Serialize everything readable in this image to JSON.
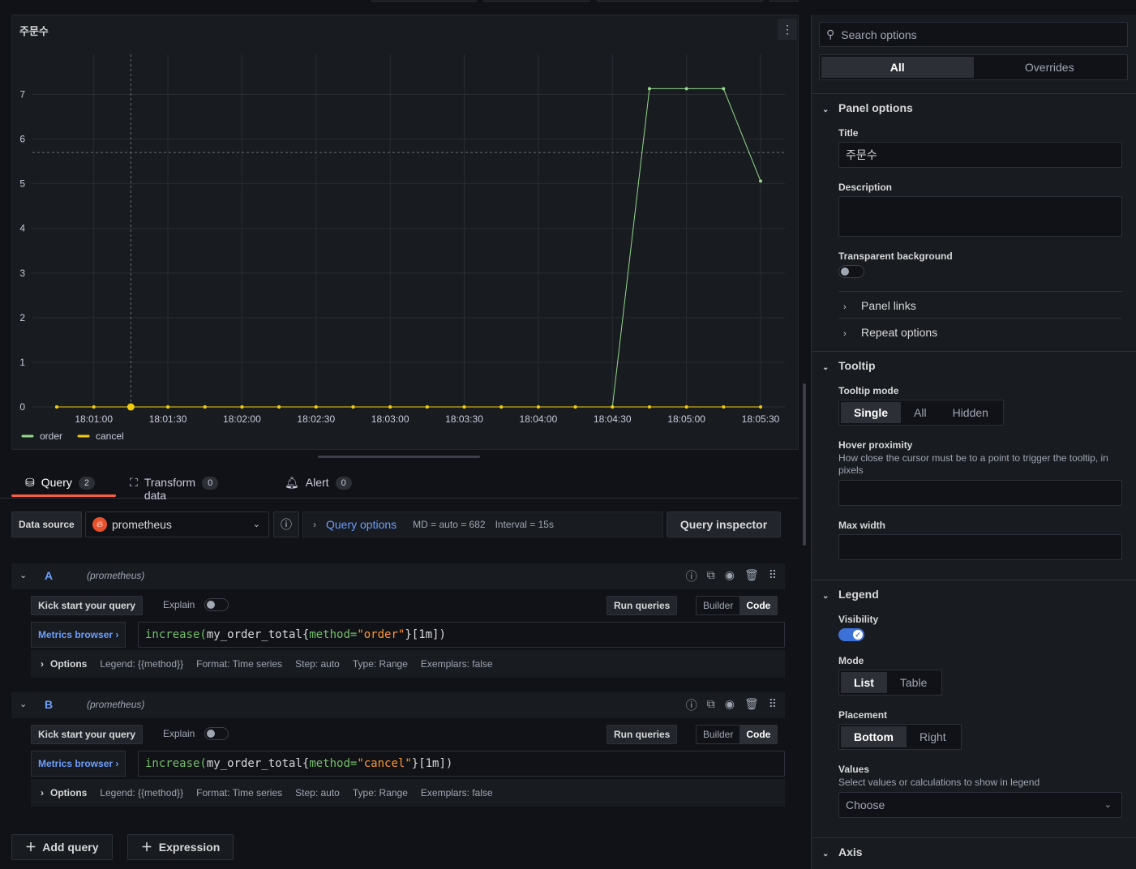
{
  "panel": {
    "title": "주문수",
    "menu_icon": "more-vertical-icon"
  },
  "chart_data": {
    "type": "line",
    "x": [
      "18:00:45",
      "18:01:00",
      "18:01:15",
      "18:01:30",
      "18:01:45",
      "18:02:00",
      "18:02:15",
      "18:02:30",
      "18:02:45",
      "18:03:00",
      "18:03:15",
      "18:03:30",
      "18:03:45",
      "18:04:00",
      "18:04:15",
      "18:04:30",
      "18:04:45",
      "18:05:00",
      "18:05:15",
      "18:05:30"
    ],
    "x_ticks": [
      "18:01:00",
      "18:01:30",
      "18:02:00",
      "18:02:30",
      "18:03:00",
      "18:03:30",
      "18:04:00",
      "18:04:30",
      "18:05:00",
      "18:05:30"
    ],
    "y_ticks": [
      "0",
      "1",
      "2",
      "3",
      "4",
      "5",
      "6",
      "7"
    ],
    "ylim": [
      0,
      7.9
    ],
    "series": [
      {
        "name": "order",
        "color": "#96d98d",
        "values": [
          0,
          0,
          0,
          0,
          0,
          0,
          0,
          0,
          0,
          0,
          0,
          0,
          0,
          0,
          0,
          0,
          7.13,
          7.13,
          7.13,
          5.06
        ]
      },
      {
        "name": "cancel",
        "color": "#f2cc0c",
        "values": [
          0,
          0,
          0,
          0,
          0,
          0,
          0,
          0,
          0,
          0,
          0,
          0,
          0,
          0,
          0,
          0,
          0,
          0,
          0,
          0
        ]
      }
    ],
    "legend": "bottom-left",
    "grid": true
  },
  "tabs": [
    {
      "label": "Query",
      "count": "2",
      "icon": "database-icon"
    },
    {
      "label": "Transform data",
      "count": "0",
      "icon": "transform-icon"
    },
    {
      "label": "Alert",
      "count": "0",
      "icon": "bell-icon"
    }
  ],
  "datasource": {
    "label": "Data source",
    "value": "prometheus",
    "query_options": "Query options",
    "md": "MD = auto = 682",
    "interval": "Interval = 15s",
    "inspector": "Query inspector"
  },
  "queries": [
    {
      "ref": "A",
      "source": "(prometheus)",
      "kick": "Kick start your query",
      "explain": "Explain",
      "run": "Run queries",
      "builder": "Builder",
      "code": "Code",
      "metrics": "Metrics browser ›",
      "expr_fn": "increase(",
      "expr_metric": "my_order_total",
      "expr_lbl": "method=",
      "expr_val": "\"order\"",
      "expr_tail": "}[1m])",
      "options": "Options",
      "legend": "Legend: {{method}}",
      "format": "Format: Time series",
      "step": "Step: auto",
      "type": "Type: Range",
      "exemplars": "Exemplars: false"
    },
    {
      "ref": "B",
      "source": "(prometheus)",
      "kick": "Kick start your query",
      "explain": "Explain",
      "run": "Run queries",
      "builder": "Builder",
      "code": "Code",
      "metrics": "Metrics browser ›",
      "expr_fn": "increase(",
      "expr_metric": "my_order_total",
      "expr_lbl": "method=",
      "expr_val": "\"cancel\"",
      "expr_tail": "}[1m])",
      "options": "Options",
      "legend": "Legend: {{method}}",
      "format": "Format: Time series",
      "step": "Step: auto",
      "type": "Type: Range",
      "exemplars": "Exemplars: false"
    }
  ],
  "add_query": "Add query",
  "expression": "Expression",
  "options_pane": {
    "search_placeholder": "Search options",
    "tab_all": "All",
    "tab_overrides": "Overrides",
    "panel_options": "Panel options",
    "title_label": "Title",
    "title_value": "주문수",
    "description_label": "Description",
    "transparent_label": "Transparent background",
    "panel_links": "Panel links",
    "repeat_options": "Repeat options",
    "tooltip": "Tooltip",
    "tooltip_mode_label": "Tooltip mode",
    "tooltip_modes": [
      "Single",
      "All",
      "Hidden"
    ],
    "hover_label": "Hover proximity",
    "hover_desc": "How close the cursor must be to a point to trigger the tooltip, in pixels",
    "max_width_label": "Max width",
    "legend": "Legend",
    "visibility_label": "Visibility",
    "mode_label": "Mode",
    "modes": [
      "List",
      "Table"
    ],
    "placement_label": "Placement",
    "placements": [
      "Bottom",
      "Right"
    ],
    "values_label": "Values",
    "values_desc": "Select values or calculations to show in legend",
    "values_placeholder": "Choose",
    "axis": "Axis"
  }
}
